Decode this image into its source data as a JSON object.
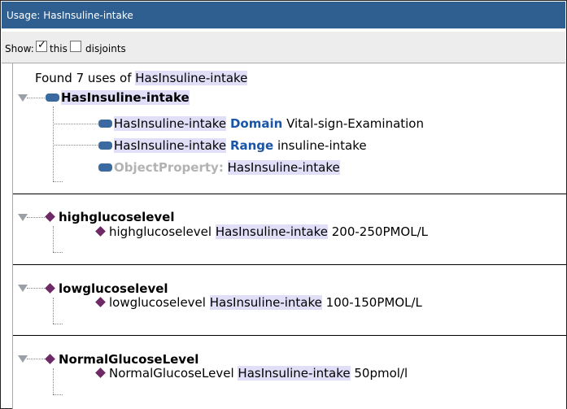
{
  "window": {
    "title": "Usage: HasInsuline-intake"
  },
  "toolbar": {
    "show_label": "Show:",
    "this_label": "this",
    "this_checked": true,
    "disjoints_label": "disjoints",
    "disjoints_checked": false
  },
  "summary": {
    "prefix": "Found 7 uses of ",
    "term": "HasInsuline-intake"
  },
  "groups": [
    {
      "title": "HasInsuline-intake",
      "items": [
        {
          "subject": "HasInsuline-intake",
          "keyword": "Domain",
          "object": "Vital-sign-Examination"
        },
        {
          "subject": "HasInsuline-intake",
          "keyword": "Range",
          "object": "insuline-intake"
        },
        {
          "keyword": "ObjectProperty:",
          "object": "HasInsuline-intake"
        }
      ]
    },
    {
      "title": "highglucoselevel",
      "items": [
        {
          "subject": "highglucoselevel",
          "property": "HasInsuline-intake",
          "value": "200-250PMOL/L"
        }
      ]
    },
    {
      "title": "lowglucoselevel",
      "items": [
        {
          "subject": "lowglucoselevel",
          "property": "HasInsuline-intake",
          "value": "100-150PMOL/L"
        }
      ]
    },
    {
      "title": "NormalGlucoseLevel",
      "items": [
        {
          "subject": "NormalGlucoseLevel",
          "property": "HasInsuline-intake",
          "value": "50pmol/l"
        }
      ]
    }
  ],
  "colors": {
    "titlebar": "#2f5f91",
    "highlight": "#e1def8",
    "keyword": "#1a55a6",
    "property_icon": "#3b6aa0",
    "individual_icon": "#6e2a67"
  },
  "icons": {
    "property": "object-property-icon",
    "individual": "individual-diamond-icon",
    "expand": "expand-triangle-icon"
  }
}
